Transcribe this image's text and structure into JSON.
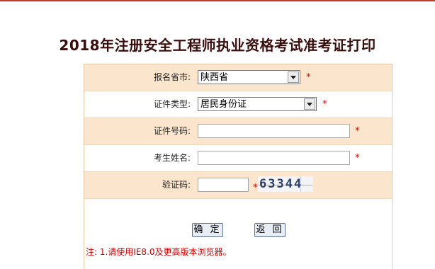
{
  "title": "2018年注册安全工程师执业资格考试准考证打印",
  "form": {
    "province": {
      "label": "报名省市:",
      "value": "陕西省",
      "required_mark": "*"
    },
    "id_type": {
      "label": "证件类型:",
      "value": "居民身份证",
      "required_mark": "*"
    },
    "id_number": {
      "label": "证件号码:",
      "value": "",
      "required_mark": "*"
    },
    "name": {
      "label": "考生姓名:",
      "value": "",
      "required_mark": "*"
    },
    "captcha": {
      "label": "验证码:",
      "value": "",
      "required_mark": "*",
      "image_text": "63344"
    }
  },
  "buttons": {
    "confirm": "确 定",
    "back": "返 回"
  },
  "note": "注: 1.请使用IE8.0及更高版本浏览器。",
  "colors": {
    "row_alt": "#fbe6cd",
    "border": "#e6c7a3",
    "required": "#e00000",
    "title": "#3a0d0d"
  }
}
